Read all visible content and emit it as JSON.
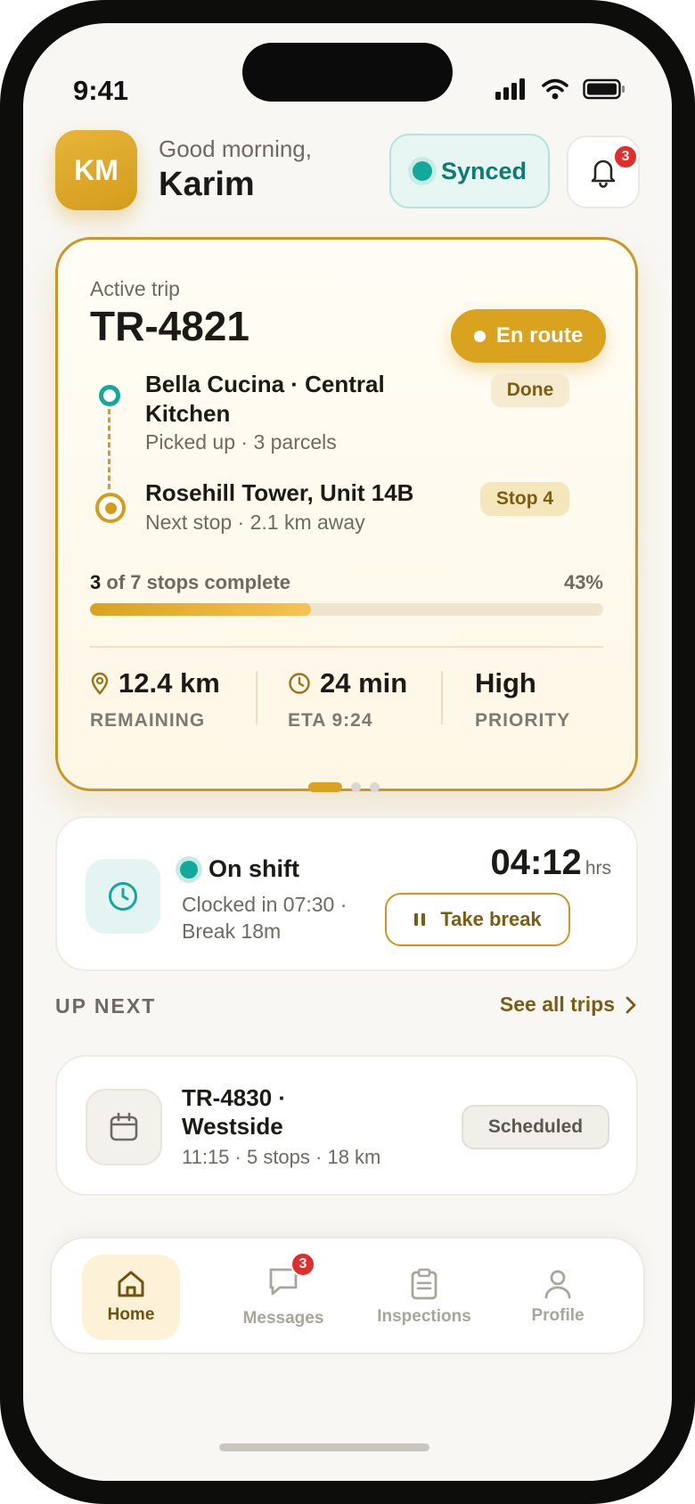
{
  "status_bar": {
    "time": "9:41"
  },
  "header": {
    "avatar_initials": "KM",
    "greeting": "Good morning,",
    "user_name": "Karim",
    "sync_status": "Synced",
    "notification_count": "3"
  },
  "active_trip": {
    "label": "Active trip",
    "trip_id": "TR-4821",
    "status": "En route",
    "stops": [
      {
        "title": "Bella Cucina · Central Kitchen",
        "subtitle": "Picked up · 3 parcels",
        "tag": "Done"
      },
      {
        "title": "Rosehill Tower, Unit 14B",
        "subtitle": "Next stop · 2.1 km away",
        "tag": "Stop 4"
      }
    ],
    "progress": {
      "completed": "3",
      "suffix": "of 7 stops complete",
      "percent_label": "43%",
      "fraction": 0.43
    },
    "metrics": [
      {
        "value": "12.4 km",
        "label": "REMAINING",
        "icon": "location-pin-icon"
      },
      {
        "value": "24 min",
        "label": "ETA 9:24",
        "icon": "clock-icon"
      },
      {
        "value": "High",
        "label": "PRIORITY"
      }
    ],
    "carousel": {
      "count": 3,
      "active_index": 0
    }
  },
  "shift": {
    "status": "On shift",
    "clock_line1": "Clocked in 07:30 ·",
    "clock_line2": "Break 18m",
    "elapsed": "04:12",
    "elapsed_unit": "hrs",
    "break_button": "Take break"
  },
  "up_next": {
    "section_title": "UP NEXT",
    "see_all": "See all trips",
    "trip": {
      "title_line1": "TR-4830 ·",
      "title_line2": "Westside",
      "subtitle": "11:15 · 5 stops · 18 km",
      "status": "Scheduled"
    }
  },
  "tabs": [
    {
      "label": "Home",
      "icon": "home-icon",
      "active": true
    },
    {
      "label": "Messages",
      "icon": "chat-icon",
      "badge": "3"
    },
    {
      "label": "Inspections",
      "icon": "clipboard-icon"
    },
    {
      "label": "Profile",
      "icon": "user-icon"
    }
  ],
  "colors": {
    "accent": "#d9a21f",
    "teal": "#13a89c",
    "badge_red": "#e32d2d"
  }
}
